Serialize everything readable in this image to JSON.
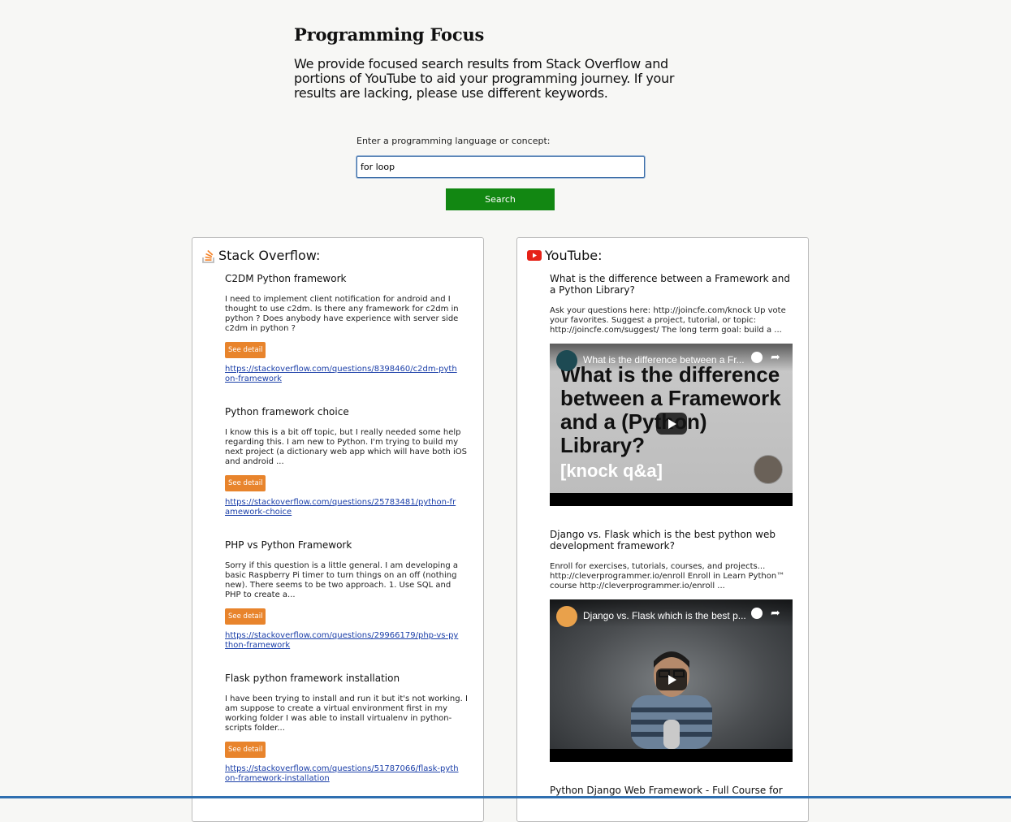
{
  "header": {
    "title": "Programming Focus",
    "subtitle": "We provide focused search results from Stack Overflow and portions of YouTube to aid your programming journey. If your results are lacking, please use different keywords."
  },
  "search": {
    "label": "Enter a programming language or concept:",
    "value": "for loop",
    "button_label": "Search"
  },
  "stackoverflow": {
    "heading": "Stack Overflow:",
    "detail_label": "See detail",
    "items": [
      {
        "title": "C2DM Python framework",
        "desc": "I need to implement client notification for android and I thought to use c2dm. Is there any framework for c2dm in python ? Does anybody have experience with server side c2dm in python ?",
        "link": "https://stackoverflow.com/questions/8398460/c2dm-python-framework"
      },
      {
        "title": "Python framework choice",
        "desc": "I know this is a bit off topic, but I really needed some help regarding this. I am new to Python. I'm trying to build my next project (a dictionary web app which will have both iOS and android ...",
        "link": "https://stackoverflow.com/questions/25783481/python-framework-choice"
      },
      {
        "title": "PHP vs Python Framework",
        "desc": "Sorry if this question is a little general. I am developing a basic Raspberry Pi timer to turn things on an off (nothing new). There seems to be two approach. 1. Use SQL and PHP to create a...",
        "link": "https://stackoverflow.com/questions/29966179/php-vs-python-framework"
      },
      {
        "title": "Flask python framework installation",
        "desc": "I have been trying to install and run it but it's not working. I am suppose to create a virtual environment first in my working folder I was able to install virtualenv in python-scripts folder...",
        "link": "https://stackoverflow.com/questions/51787066/flask-python-framework-installation"
      }
    ]
  },
  "youtube": {
    "heading": "YouTube:",
    "items": [
      {
        "title": "What is the difference between a Framework and a Python Library?",
        "desc": "Ask your questions here: http://joincfe.com/knock Up vote your favorites. Suggest a project, tutorial, or topic: http://joincfe.com/suggest/ The long term goal: build a ...",
        "video_title": "What is the difference between a Fr...",
        "overlay": "What is the difference between a Framework and a (Python) Library?",
        "overlay_sub": "[knock q&a]"
      },
      {
        "title": "Django vs. Flask which is the best python web development framework?",
        "desc": "Enroll for exercises, tutorials, courses, and projects... http://cleverprogrammer.io/enroll Enroll in Learn Python™ course http://cleverprogrammer.io/enroll ...",
        "video_title": "Django vs. Flask which is the best p..."
      },
      {
        "title": "Python Django Web Framework - Full Course for"
      }
    ]
  },
  "colors": {
    "search_button": "#128712",
    "detail_button": "#e8842c",
    "link": "#1a3ea8",
    "youtube_red": "#e62117",
    "stackoverflow_orange": "#f48024"
  }
}
